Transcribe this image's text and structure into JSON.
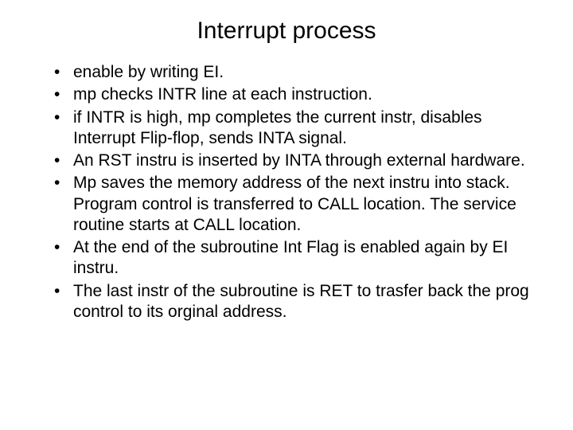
{
  "slide": {
    "title": "Interrupt process",
    "bullets": [
      "enable by writing EI.",
      "mp checks INTR line at each instruction.",
      "if INTR is high, mp completes the current instr, disables Interrupt Flip-flop, sends INTA signal.",
      "An RST instru is inserted by INTA through external hardware.",
      "Mp saves the memory address of the next instru into stack. Program control is transferred to CALL location. The service routine starts at CALL location.",
      "At the end of the subroutine Int Flag is enabled again by EI instru.",
      "The last instr of the subroutine is RET to trasfer back the prog control to its orginal address."
    ]
  }
}
